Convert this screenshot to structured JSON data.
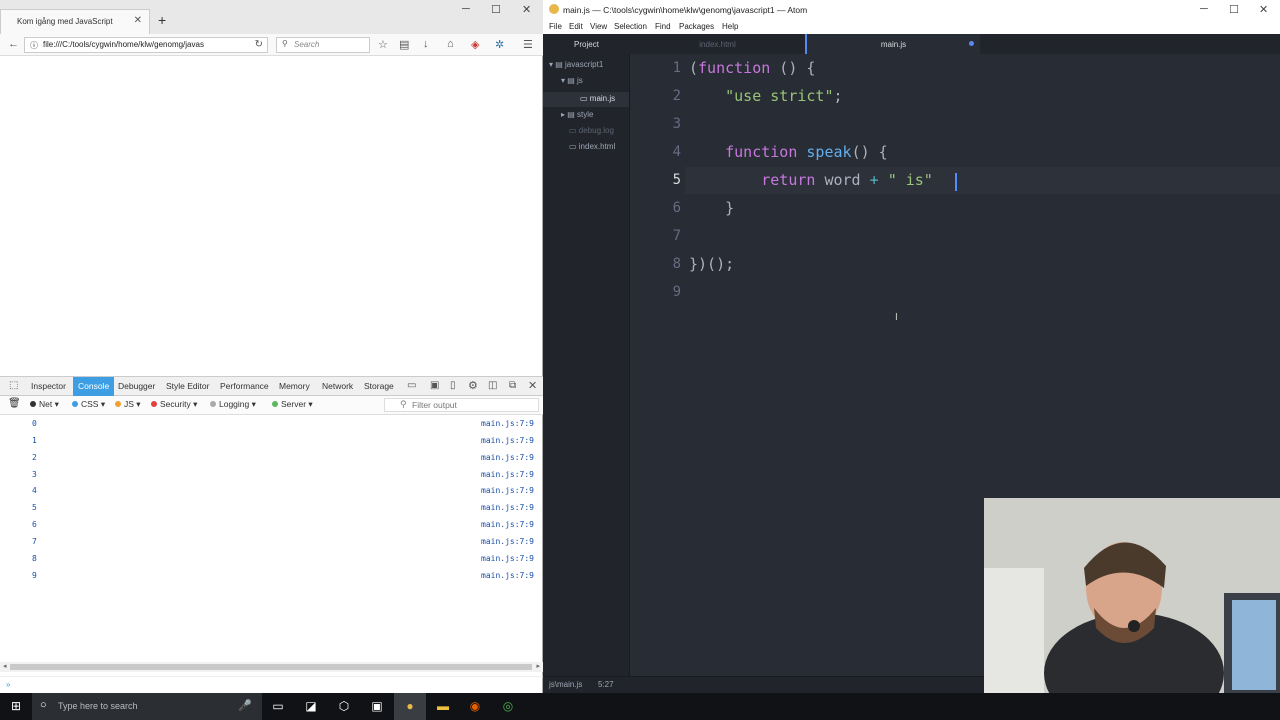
{
  "firefox": {
    "tab_title": "Kom igång med JavaScript",
    "url": "file:///C:/tools/cygwin/home/klw/genomg/javas",
    "search_placeholder": "Search",
    "devtools_tabs": [
      "Inspector",
      "Console",
      "Debugger",
      "Style Editor",
      "Performance",
      "Memory",
      "Network",
      "Storage"
    ],
    "active_tab": "Console",
    "filters": {
      "net": "Net",
      "css": "CSS",
      "js": "JS",
      "security": "Security",
      "logging": "Logging",
      "server": "Server"
    },
    "filter_placeholder": "Filter output",
    "console_rows": [
      {
        "value": "0",
        "source": "main.js:7:9"
      },
      {
        "value": "1",
        "source": "main.js:7:9"
      },
      {
        "value": "2",
        "source": "main.js:7:9"
      },
      {
        "value": "3",
        "source": "main.js:7:9"
      },
      {
        "value": "4",
        "source": "main.js:7:9"
      },
      {
        "value": "5",
        "source": "main.js:7:9"
      },
      {
        "value": "6",
        "source": "main.js:7:9"
      },
      {
        "value": "7",
        "source": "main.js:7:9"
      },
      {
        "value": "8",
        "source": "main.js:7:9"
      },
      {
        "value": "9",
        "source": "main.js:7:9"
      }
    ],
    "colors": {
      "active_tab": "#3d9ee3",
      "net": "#333333",
      "css": "#3d9ee3",
      "js": "#f0a030",
      "security": "#e04040",
      "logging": "#aaaaaa",
      "server": "#5cb85c"
    }
  },
  "atom": {
    "window_title": "main.js — C:\\tools\\cygwin\\home\\klw\\genomg\\javascript1 — Atom",
    "menu": [
      "File",
      "Edit",
      "View",
      "Selection",
      "Find",
      "Packages",
      "Help"
    ],
    "panel_tab": "Project",
    "tabs": [
      {
        "label": "index.html"
      },
      {
        "label": "main.js"
      }
    ],
    "tree": {
      "root": "javascript1",
      "js_folder": "js",
      "main_file": "main.js",
      "style_folder": "style",
      "debug_file": "debug.log",
      "index_file": "index.html"
    },
    "line_numbers": [
      "1",
      "2",
      "3",
      "4",
      "5",
      "6",
      "7",
      "8",
      "9"
    ],
    "status_path": "js\\main.js",
    "status_pos": "5:27"
  },
  "taskbar": {
    "search_placeholder": "Type here to search"
  }
}
